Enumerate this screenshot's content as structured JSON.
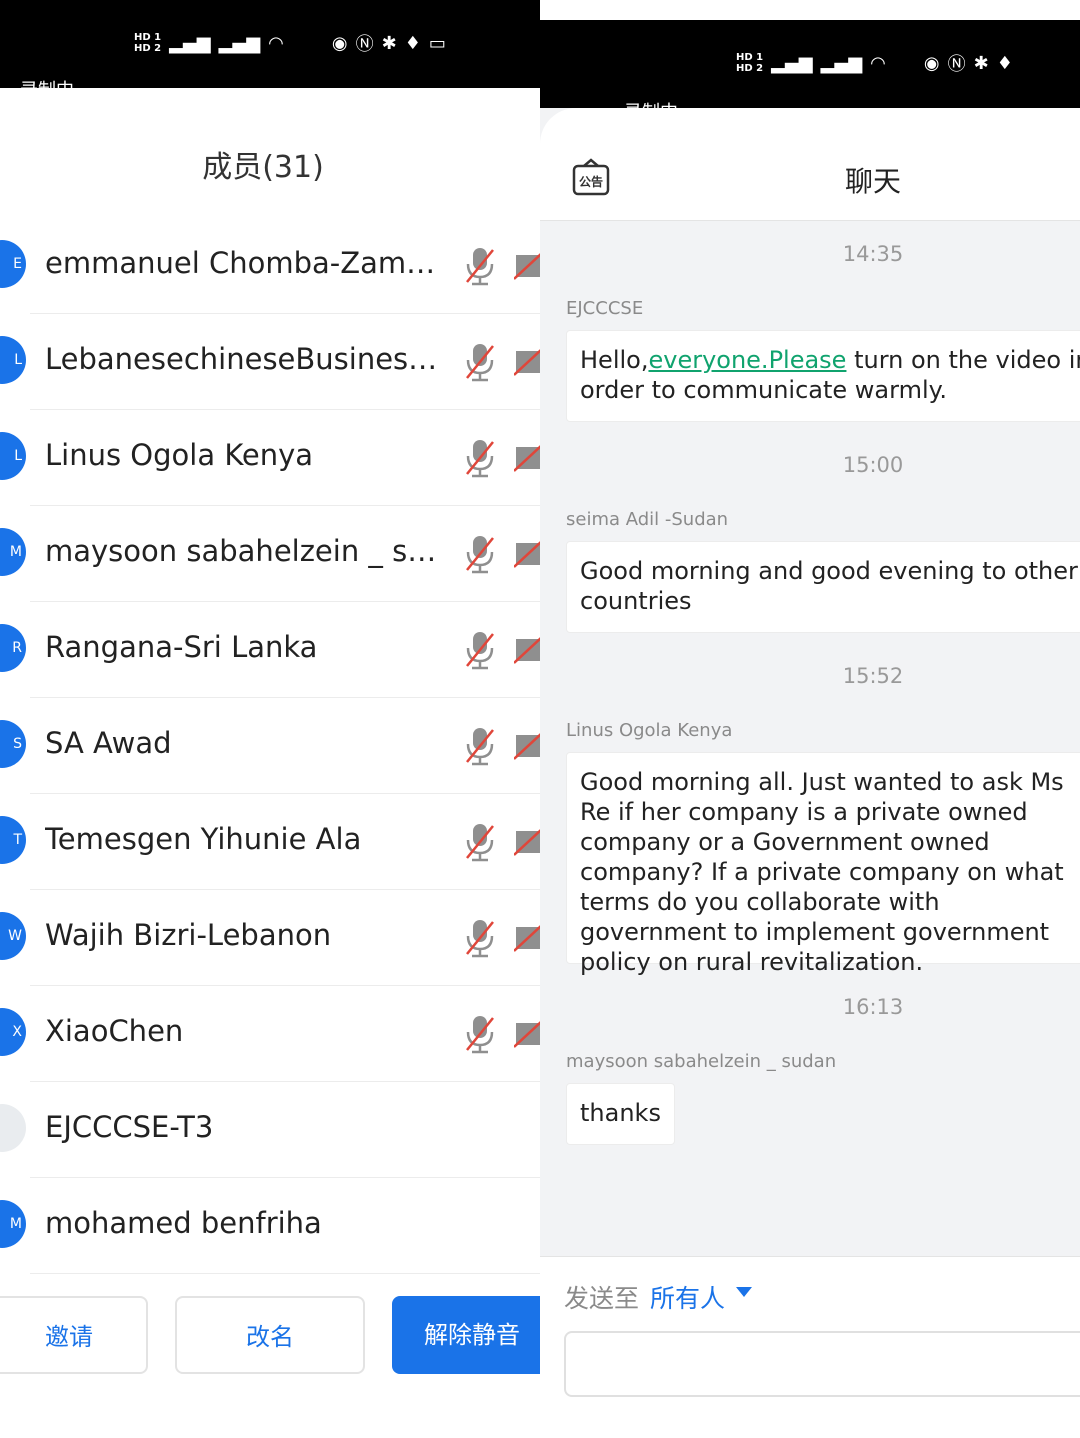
{
  "members_panel": {
    "status_bar": {
      "recording": "录制中"
    },
    "title": "成员(31)",
    "members": [
      {
        "name": "emmanuel Chomba-Zambia",
        "avatar": "E",
        "has_controls": true
      },
      {
        "name": "LebanesechineseBusinessA…",
        "avatar": "L",
        "has_controls": true
      },
      {
        "name": "Linus Ogola Kenya",
        "avatar": "L",
        "has_controls": true
      },
      {
        "name": "maysoon sabahelzein _ sudan",
        "avatar": "M",
        "has_controls": true
      },
      {
        "name": "Rangana-Sri Lanka",
        "avatar": "R",
        "has_controls": true
      },
      {
        "name": "SA Awad",
        "avatar": "S",
        "has_controls": true
      },
      {
        "name": "Temesgen Yihunie Ala",
        "avatar": "T",
        "has_controls": true
      },
      {
        "name": "Wajih Bizri-Lebanon",
        "avatar": "W",
        "has_controls": true
      },
      {
        "name": "XiaoChen",
        "avatar": "X",
        "has_controls": true
      },
      {
        "name": "EJCCCSE-T3",
        "avatar": "",
        "has_controls": false
      },
      {
        "name": "mohamed benfriha",
        "avatar": "M",
        "has_controls": false
      }
    ],
    "buttons": {
      "invite": "邀请",
      "rename": "改名",
      "unmute": "解除静音"
    }
  },
  "chat_panel": {
    "status_bar": {
      "recording": "录制中"
    },
    "title": "聊天",
    "notice_icon_label": "公告",
    "messages": [
      {
        "time": "14:35",
        "sender": "EJCCCSE",
        "text_before": "Hello,",
        "link": "everyone.Please",
        "text_after": " turn on the video in order to communicate warmly."
      },
      {
        "time": "15:00",
        "sender": "seima Adil -Sudan",
        "text": "Good morning and good evening to other countries"
      },
      {
        "time": "15:52",
        "sender": "Linus Ogola Kenya",
        "text": "Good morning all. Just wanted to ask Ms Re if her company is a private owned company or a Government owned company? If a private company on what terms do you collaborate with government to implement government policy on rural revitalization."
      },
      {
        "time": "16:13",
        "sender": "maysoon sabahelzein _ sudan",
        "text": "thanks"
      }
    ],
    "compose": {
      "send_to_label": "发送至",
      "send_to_target": "所有人",
      "input_value": ""
    }
  },
  "colors": {
    "accent": "#1a73e8",
    "link": "#10a36e",
    "panel_bg": "#f2f3f5"
  }
}
